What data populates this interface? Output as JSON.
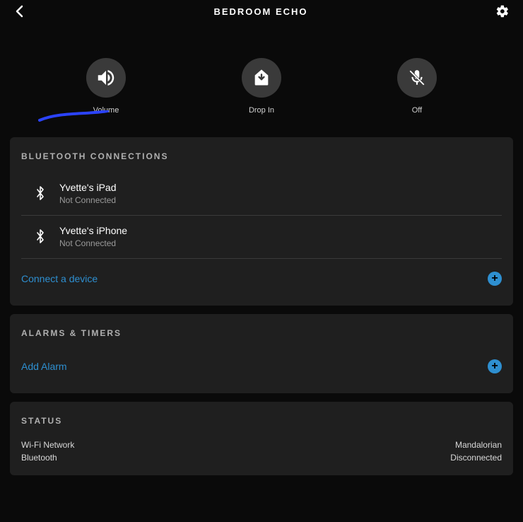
{
  "header": {
    "title": "BEDROOM ECHO"
  },
  "actions": {
    "volume": {
      "label": "Volume"
    },
    "dropin": {
      "label": "Drop In"
    },
    "off": {
      "label": "Off"
    }
  },
  "bluetooth": {
    "heading": "BLUETOOTH CONNECTIONS",
    "items": [
      {
        "name": "Yvette's iPad",
        "status": "Not Connected"
      },
      {
        "name": "Yvette's iPhone",
        "status": "Not Connected"
      }
    ],
    "connect_label": "Connect a device"
  },
  "alarms": {
    "heading": "ALARMS & TIMERS",
    "add_label": "Add Alarm"
  },
  "status": {
    "heading": "STATUS",
    "wifi_label": "Wi-Fi Network",
    "wifi_value": "Mandalorian",
    "bt_label": "Bluetooth",
    "bt_value": "Disconnected"
  },
  "colors": {
    "accent": "#2e8fd0",
    "annotation": "#2b43ff"
  }
}
